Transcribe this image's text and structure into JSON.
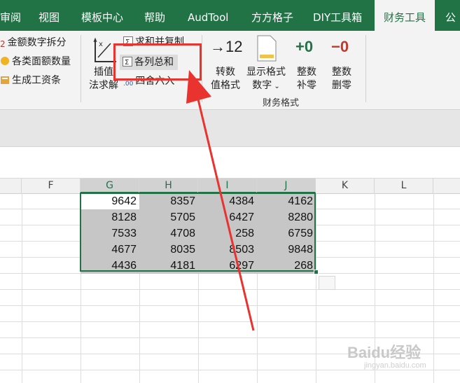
{
  "tabs": [
    {
      "label": "审阅"
    },
    {
      "label": "视图"
    },
    {
      "label": "模板中心"
    },
    {
      "label": "帮助"
    },
    {
      "label": "AudTool"
    },
    {
      "label": "方方格子"
    },
    {
      "label": "DIY工具箱"
    },
    {
      "label": "财务工具",
      "active": true
    },
    {
      "label": "公"
    }
  ],
  "ribbon": {
    "left_items": [
      "金额数字拆分",
      "各类面额数量",
      "生成工资条"
    ],
    "interp_label1": "插值",
    "interp_label2": "法求解",
    "sum_copy": "求和并复制",
    "col_total": "各列总和",
    "round": "四舍六入",
    "round_prefix": ".00",
    "convert_icon": "→12",
    "convert_label1": "转数",
    "convert_label2": "值格式",
    "display_label1": "显示格式",
    "display_label2": "数字",
    "pad_icon": "+0",
    "pad_label1": "整数",
    "pad_label2": "补零",
    "del_icon": "−0",
    "del_label1": "整数",
    "del_label2": "删零",
    "group_label": "财务格式"
  },
  "grid": {
    "columns": [
      "F",
      "G",
      "H",
      "I",
      "J",
      "K",
      "L"
    ],
    "rows": [
      [
        9642,
        8357,
        4384,
        4162
      ],
      [
        8128,
        5705,
        6427,
        8280
      ],
      [
        7533,
        4708,
        258,
        6759
      ],
      [
        4677,
        8035,
        8503,
        9848
      ],
      [
        4436,
        4181,
        6297,
        268
      ]
    ]
  },
  "watermark": {
    "text": "Baidu经验",
    "sub": "jingyan.baidu.com"
  },
  "colors": {
    "accent": "#217346",
    "highlight": "#e8332f"
  }
}
